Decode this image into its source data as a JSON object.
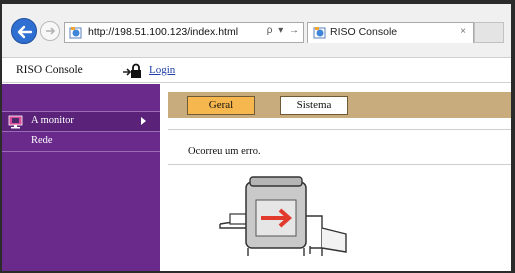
{
  "browser": {
    "url": "http://198.51.100.123/index.html",
    "addr_tools": [
      "ρ",
      "▾",
      "→"
    ],
    "tab_title": "RISO Console",
    "tab_close": "×"
  },
  "header": {
    "brand": "RISO Console",
    "login_label": "Login"
  },
  "sidebar": {
    "items": [
      {
        "label": "A monitor",
        "active": true
      },
      {
        "label": "Rede",
        "active": false
      }
    ]
  },
  "main": {
    "tabs": [
      {
        "label": "Geral",
        "selected": true
      },
      {
        "label": "Sistema",
        "selected": false
      }
    ],
    "error_message": "Ocorreu um erro."
  },
  "colors": {
    "sidebar": "#6a2a8c",
    "tab_bar": "#c8ac7e",
    "tab_selected": "#f6b84e",
    "arrow": "#e23b2e"
  },
  "icons": {
    "back": "back-arrow-icon",
    "forward": "forward-arrow-icon",
    "site": "ie-page-icon",
    "login": "padlock-icon",
    "monitor": "monitor-icon",
    "printer": "printer-error-illustration"
  }
}
